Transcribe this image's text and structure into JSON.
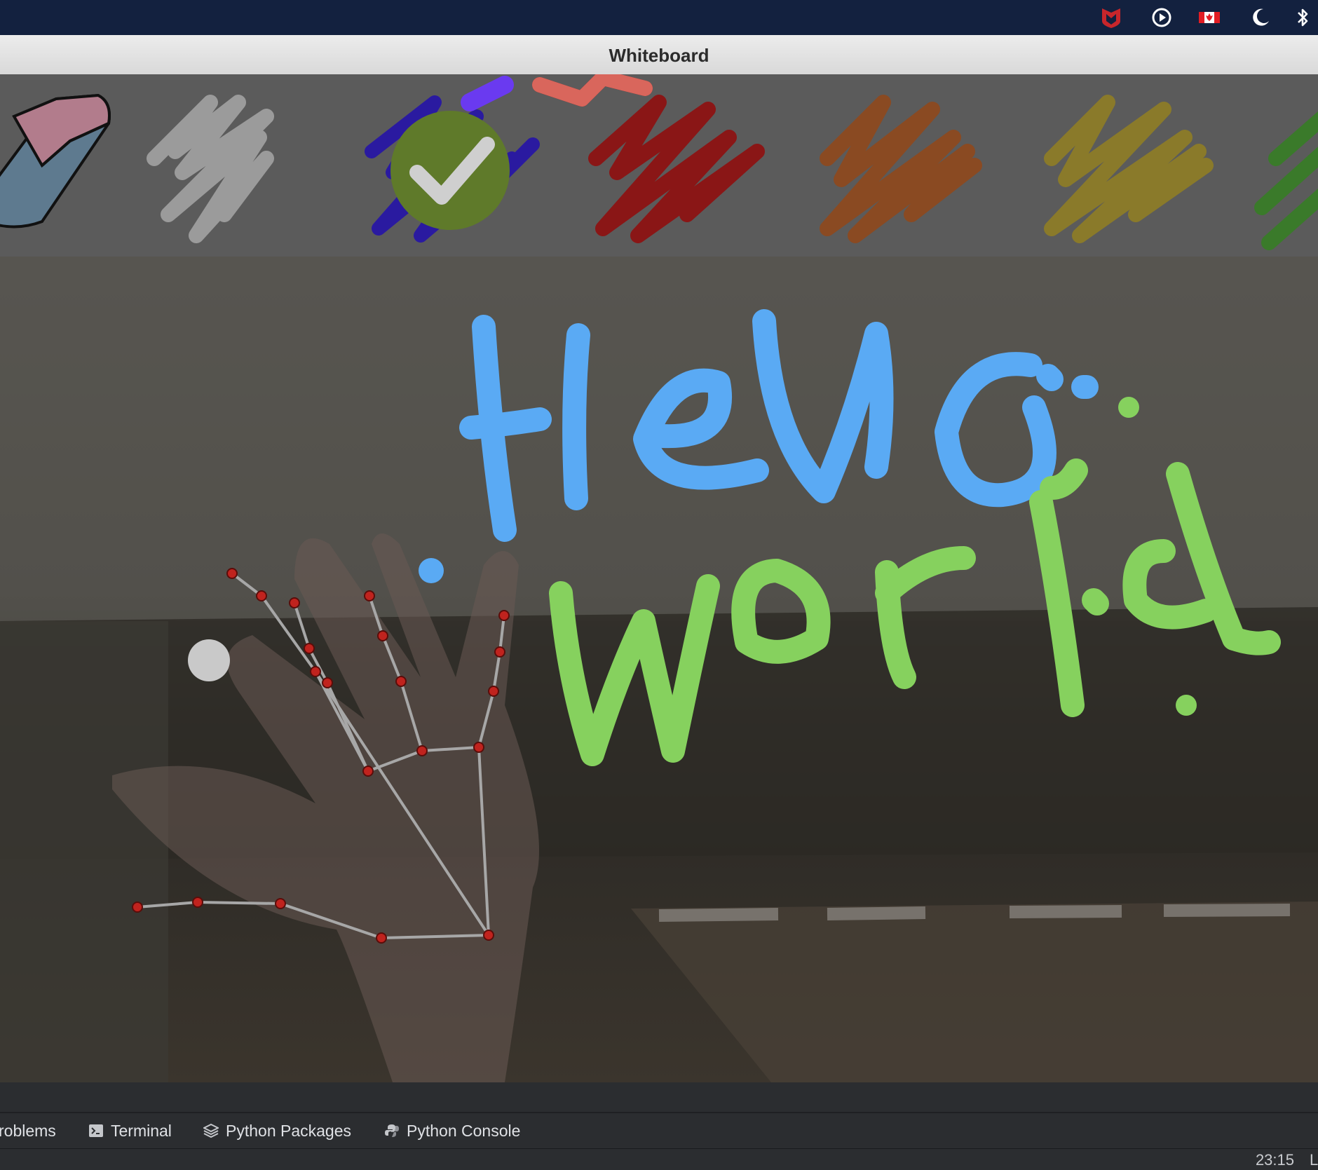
{
  "window": {
    "title": "Whiteboard"
  },
  "menubar": {
    "icons": [
      "mcafee-shield-icon",
      "play-circle-icon",
      "canada-flag-icon",
      "moon-icon",
      "bluetooth-icon"
    ]
  },
  "palette": {
    "tools": [
      {
        "name": "eraser",
        "color": "#8a5a6a"
      },
      {
        "name": "gray",
        "color": "#9a9a9a"
      },
      {
        "name": "blue",
        "color": "#2a1aa0",
        "selected": true
      },
      {
        "name": "red",
        "color": "#8a1616"
      },
      {
        "name": "orange",
        "color": "#8a4a22"
      },
      {
        "name": "yellow",
        "color": "#8a7a2a"
      },
      {
        "name": "green",
        "color": "#3a7a2a"
      }
    ],
    "selection_check_color": "#5f7a2a"
  },
  "drawing": {
    "line1_text": "Hello",
    "line1_color": "#5aaaf4",
    "line2_text": "World",
    "line2_color": "#86d15e"
  },
  "toolwindows": {
    "problems": "roblems",
    "terminal": "Terminal",
    "python_packages": "Python Packages",
    "python_console": "Python Console"
  },
  "status": {
    "time": "23:15",
    "encoding": "L"
  }
}
